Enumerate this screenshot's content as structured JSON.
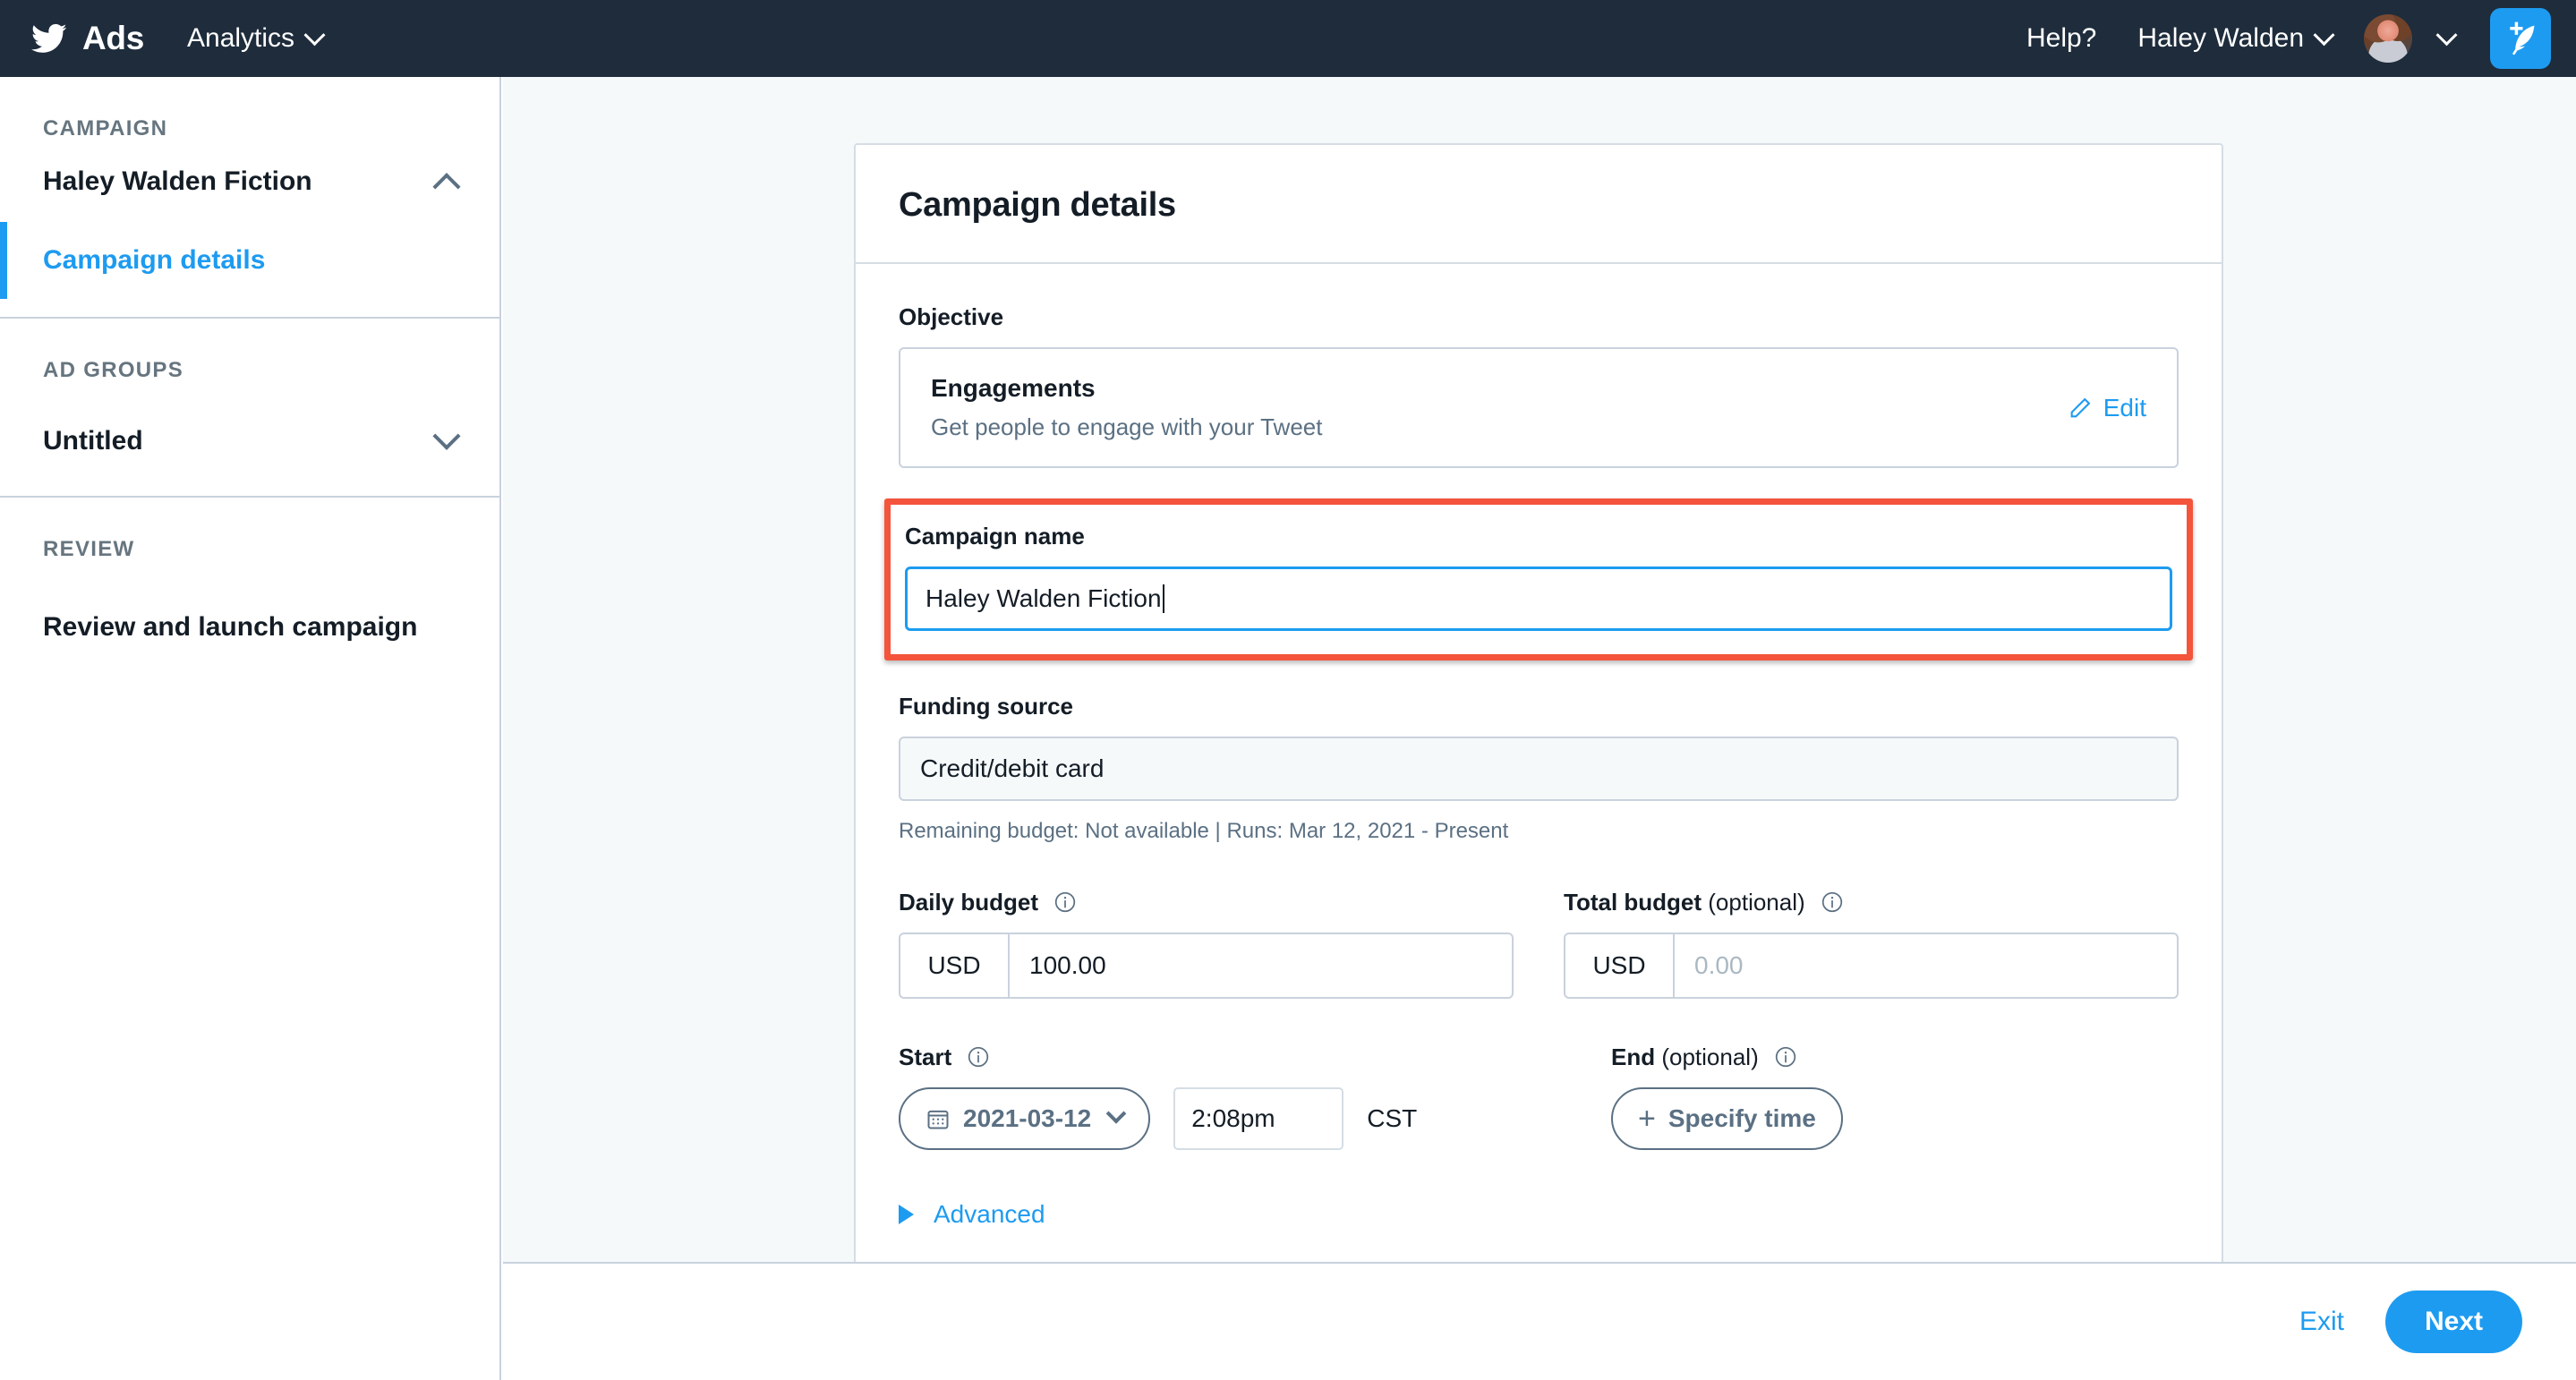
{
  "topnav": {
    "brand": "Ads",
    "bird_icon": "twitter-bird-icon",
    "analytics": "Analytics",
    "help": "Help?",
    "user": "Haley Walden",
    "compose_icon": "compose-tweet-icon",
    "bg_color": "#1e2c3c"
  },
  "sidebar": {
    "campaign_label": "CAMPAIGN",
    "campaign_name": "Haley Walden Fiction",
    "campaign_details": "Campaign details",
    "adgroups_label": "AD GROUPS",
    "adgroup_name": "Untitled",
    "review_label": "REVIEW",
    "review_item": "Review and launch campaign",
    "active_color": "#1d9bf0"
  },
  "card": {
    "title": "Campaign details",
    "objective": {
      "label": "Objective",
      "name": "Engagements",
      "description": "Get people to engage with your Tweet",
      "edit_label": "Edit"
    },
    "campaign_name": {
      "label": "Campaign name",
      "value": "Haley Walden Fiction",
      "highlight_color": "#f4543c",
      "focus_color": "#1d9bf0"
    },
    "funding": {
      "label": "Funding source",
      "value": "Credit/debit card",
      "helper": "Remaining budget: Not available | Runs: Mar 12, 2021 - Present"
    },
    "daily_budget": {
      "label": "Daily budget",
      "currency": "USD",
      "value": "100.00"
    },
    "total_budget": {
      "label": "Total budget",
      "optional": " (optional)",
      "currency": "USD",
      "placeholder": "0.00"
    },
    "start": {
      "label": "Start",
      "date": "2021-03-12",
      "time": "2:08pm",
      "timezone": "CST",
      "calendar_icon": "calendar-icon"
    },
    "end": {
      "label": "End",
      "optional": " (optional)",
      "specify_time": "Specify time"
    },
    "advanced": "Advanced"
  },
  "footer": {
    "exit": "Exit",
    "next": "Next",
    "accent_color": "#1d9bf0"
  }
}
